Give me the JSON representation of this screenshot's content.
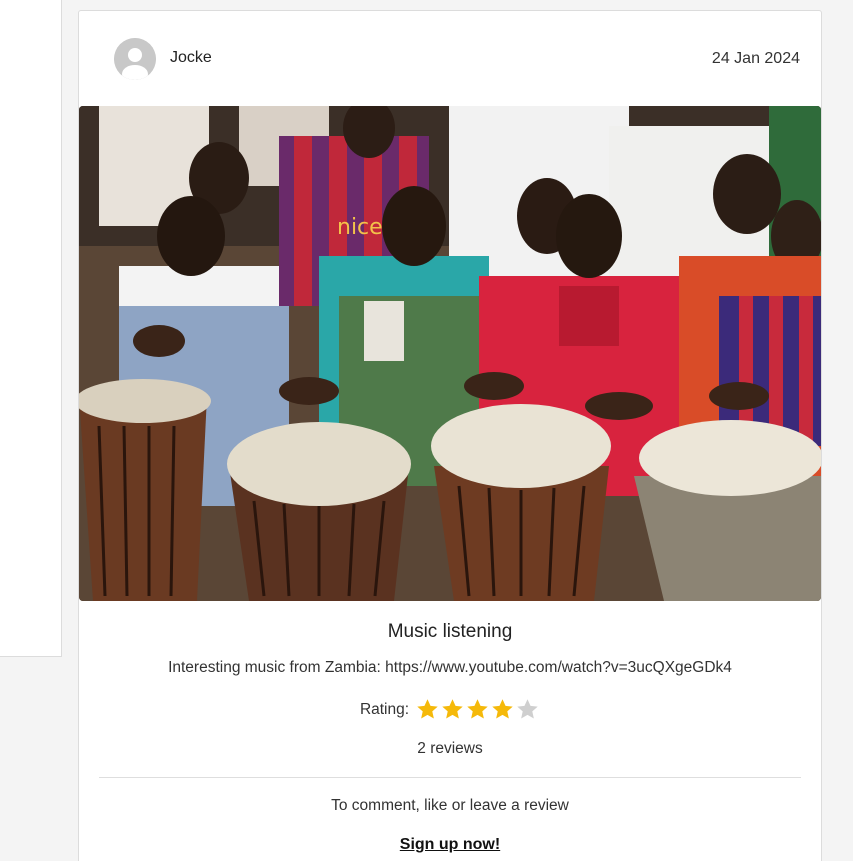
{
  "post": {
    "author": "Jocke",
    "date": "24 Jan 2024",
    "title": "Music listening",
    "description": "Interesting music from Zambia: https://www.youtube.com/watch?v=3ucQXgeGDk4",
    "rating_label": "Rating:",
    "rating_value": 4,
    "rating_max": 5,
    "reviews": "2 reviews",
    "photo_shirt_text": "nice"
  },
  "footer": {
    "comment_prompt": "To comment, like or leave a review",
    "signup_label": "Sign up now!"
  },
  "colors": {
    "star_filled": "#f5b90a",
    "star_empty": "#cfcfcf",
    "avatar_bg": "#c8c8c8"
  }
}
